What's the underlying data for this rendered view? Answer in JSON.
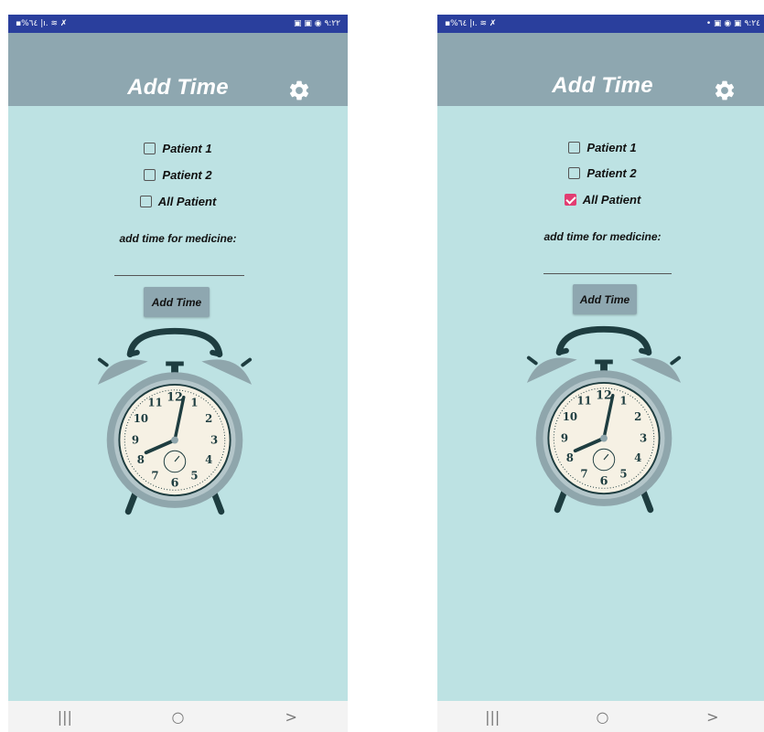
{
  "left": {
    "status": {
      "left": "▪%٦٤ |ı. ≋ ✗",
      "time": "٩:٢٢",
      "icons": "▣ ▣ ◉"
    },
    "title": "Add Time",
    "patients": [
      {
        "label": "Patient 1",
        "checked": false
      },
      {
        "label": "Patient 2",
        "checked": false
      },
      {
        "label": "All Patient",
        "checked": false
      }
    ],
    "instruction": "add time for medicine:",
    "time_value": "",
    "button_label": "Add Time",
    "nav": {
      "recent": "|||",
      "home": "○",
      "back": ">"
    }
  },
  "right": {
    "status": {
      "left": "▪%٦٤ |ı. ≋ ✗",
      "time": "٩:٢٤",
      "icons": "• ▣ ◉ ▣"
    },
    "title": "Add Time",
    "patients": [
      {
        "label": "Patient 1",
        "checked": false
      },
      {
        "label": "Patient 2",
        "checked": false
      },
      {
        "label": "All Patient",
        "checked": true
      }
    ],
    "instruction": "add time for medicine:",
    "time_value": "",
    "button_label": "Add Time",
    "nav": {
      "recent": "|||",
      "home": "○",
      "back": ">"
    }
  },
  "clock_face_numbers": [
    "12",
    "1",
    "2",
    "3",
    "4",
    "5",
    "6",
    "7",
    "8",
    "9",
    "10",
    "11"
  ],
  "colors": {
    "status_bar": "#2a3f9d",
    "app_bar": "#8ea7b0",
    "background": "#bde2e3",
    "checkbox_checked": "#e23d72",
    "button": "#8ea7b0"
  }
}
